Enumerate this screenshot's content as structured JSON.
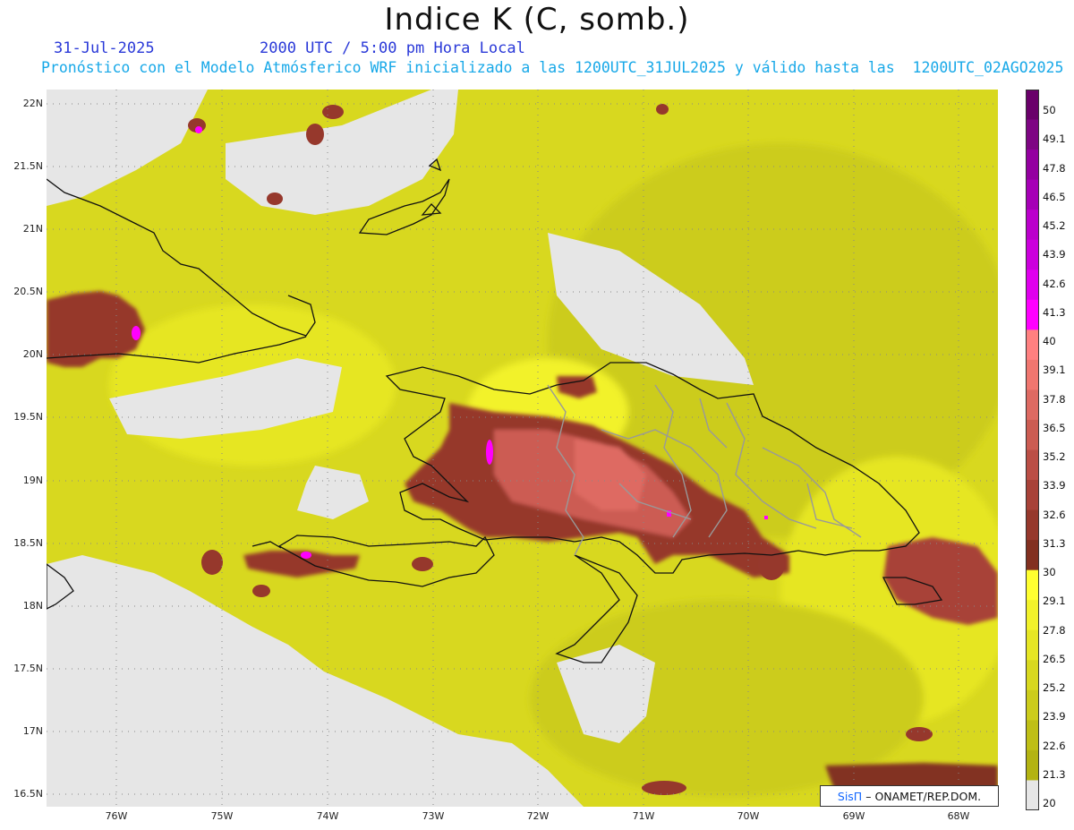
{
  "title": "Indice K (C, somb.)",
  "subtitle": {
    "date": "31-Jul-2025",
    "time": "2000 UTC / 5:00 pm Hora Local",
    "description": "Pronóstico con el Modelo Atmósferico WRF inicializado a las 1200UTC_31JUL2025 y válido hasta las  1200UTC_02AGO2025"
  },
  "map": {
    "lat_labels": [
      "22N",
      "21.5N",
      "21N",
      "20.5N",
      "20N",
      "19.5N",
      "19N",
      "18.5N",
      "18N",
      "17.5N",
      "17N",
      "16.5N"
    ],
    "lon_labels": [
      "76W",
      "75W",
      "74W",
      "73W",
      "72W",
      "71W",
      "70W",
      "69W",
      "68W"
    ],
    "lat_range": [
      16.4,
      22.1
    ],
    "lon_range": [
      -76.65,
      -67.4
    ],
    "gridlines": true,
    "land_color": "#e6e6e6"
  },
  "colorbar": {
    "levels": [
      "50",
      "49.1",
      "47.8",
      "46.5",
      "45.2",
      "43.9",
      "42.6",
      "41.3",
      "40",
      "39.1",
      "37.8",
      "36.5",
      "35.2",
      "33.9",
      "32.6",
      "31.3",
      "30",
      "29.1",
      "27.8",
      "26.5",
      "25.2",
      "23.9",
      "22.6",
      "21.3",
      "20"
    ],
    "colors": [
      "#6a006a",
      "#7e0583",
      "#9400a0",
      "#a600b6",
      "#bb00cc",
      "#cc00dd",
      "#e000ee",
      "#ff00ff",
      "#ff8080",
      "#f0766f",
      "#de6a62",
      "#cc5c52",
      "#bb4e45",
      "#a84238",
      "#96382c",
      "#823020",
      "#ffff30",
      "#f2f22a",
      "#e6e624",
      "#d8d81f",
      "#cccc1b",
      "#bfbf16",
      "#b3b312",
      "#e6e6e6"
    ]
  },
  "credit": {
    "brand": "SisΠ",
    "text": "– ONAMET/REP.DOM."
  }
}
